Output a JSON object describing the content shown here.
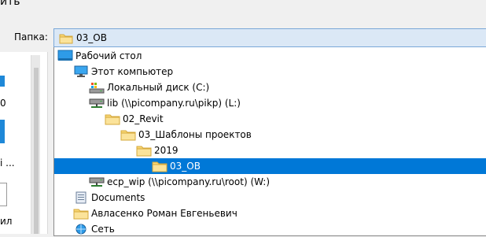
{
  "window": {
    "title_fragment": "ить"
  },
  "left_pane": {
    "text_1": "0",
    "text_2": "і ...",
    "text_3": "ил"
  },
  "folder_picker": {
    "label": "Папка:",
    "selected_value": "03_OB"
  },
  "tree": {
    "items": [
      {
        "label": "Рабочий стол",
        "icon": "desktop-icon",
        "level": 0,
        "selected": false
      },
      {
        "label": "Этот компьютер",
        "icon": "computer-icon",
        "level": 1,
        "selected": false
      },
      {
        "label": "Локальный диск (C:)",
        "icon": "local-disk-icon",
        "level": 2,
        "selected": false
      },
      {
        "label": "lib (\\\\picompany.ru\\pikp) (L:)",
        "icon": "network-drive-icon",
        "level": 2,
        "selected": false
      },
      {
        "label": "02_Revit",
        "icon": "folder-icon",
        "level": 3,
        "selected": false
      },
      {
        "label": "03_Шаблоны проектов",
        "icon": "folder-icon",
        "level": 4,
        "selected": false
      },
      {
        "label": "2019",
        "icon": "folder-icon",
        "level": 5,
        "selected": false
      },
      {
        "label": "03_OB",
        "icon": "folder-icon",
        "level": 6,
        "selected": true
      },
      {
        "label": "ecp_wip (\\\\picompany.ru\\root) (W:)",
        "icon": "network-drive-icon",
        "level": 2,
        "selected": false
      },
      {
        "label": "Documents",
        "icon": "documents-icon",
        "level": 1,
        "selected": false
      },
      {
        "label": "Авласенко Роман Евгеньевич",
        "icon": "folder-icon",
        "level": 1,
        "selected": false
      },
      {
        "label": "Сеть",
        "icon": "network-icon",
        "level": 1,
        "selected": false
      }
    ]
  },
  "colors": {
    "selection": "#0078d7",
    "combo_bg": "#dbe8f6",
    "folder": "#f8d775"
  }
}
